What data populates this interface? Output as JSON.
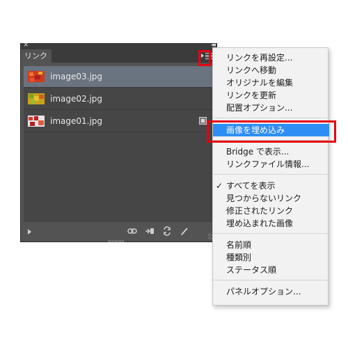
{
  "panel": {
    "tab_label": "リンク",
    "close_glyph": "×",
    "collapse_glyph": "◂◂",
    "files": [
      {
        "name": "image03.jpg",
        "selected": true,
        "embedded": false
      },
      {
        "name": "image02.jpg",
        "selected": false,
        "embedded": false
      },
      {
        "name": "image01.jpg",
        "selected": false,
        "embedded": true
      }
    ],
    "bottom_icons": [
      "relink-icon",
      "goto-link-icon",
      "update-link-icon",
      "edit-original-icon"
    ]
  },
  "menu": {
    "items": [
      {
        "label": "リンクを再設定..."
      },
      {
        "label": "リンクへ移動"
      },
      {
        "label": "オリジナルを編集"
      },
      {
        "label": "リンクを更新"
      },
      {
        "label": "配置オプション..."
      },
      {
        "label": "画像を埋め込み",
        "highlighted": true
      },
      {
        "label": "Bridge で表示..."
      },
      {
        "label": "リンクファイル情報..."
      },
      {
        "label": "すべてを表示",
        "checked": true
      },
      {
        "label": "見つからないリンク"
      },
      {
        "label": "修正されたリンク"
      },
      {
        "label": "埋め込まれた画像"
      },
      {
        "label": "名前順"
      },
      {
        "label": "種類別"
      },
      {
        "label": "ステータス順"
      },
      {
        "label": "パネルオプション..."
      }
    ],
    "check_glyph": "✓"
  },
  "colors": {
    "panel_bg": "#535353",
    "selected_row": "#6a7380",
    "menu_highlight": "#2f8ef4",
    "annotation_red": "#e8000e"
  }
}
